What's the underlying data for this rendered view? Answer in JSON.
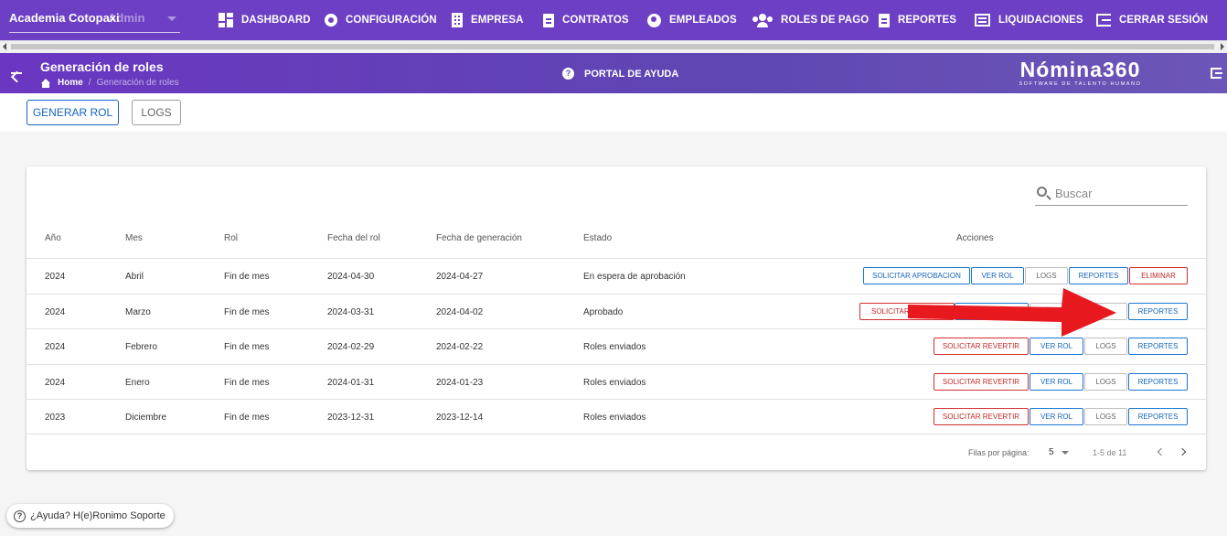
{
  "topnav": {
    "org_name": "Academia Cotopaxi",
    "org_role": "Admin",
    "items": [
      {
        "label": "DASHBOARD",
        "icon": "dashboard-icon"
      },
      {
        "label": "CONFIGURACIÓN",
        "icon": "gear-icon"
      },
      {
        "label": "EMPRESA",
        "icon": "building-icon"
      },
      {
        "label": "CONTRATOS",
        "icon": "clipboard-icon"
      },
      {
        "label": "EMPLEADOS",
        "icon": "globe-icon"
      },
      {
        "label": "ROLES DE PAGO",
        "icon": "users-icon"
      },
      {
        "label": "REPORTES",
        "icon": "clipboard-icon"
      },
      {
        "label": "LIQUIDACIONES",
        "icon": "list-icon"
      },
      {
        "label": "CERRAR SESIÓN",
        "icon": "logout-icon"
      }
    ]
  },
  "subheader": {
    "title": "Generación de roles",
    "breadcrumb_home": "Home",
    "breadcrumb_sep": "/",
    "breadcrumb_current": "Generación de roles",
    "help_portal": "PORTAL DE AYUDA",
    "brand_name": "Nómina360",
    "brand_tagline": "SOFTWARE DE TALENTO HUMANO"
  },
  "toolbar": {
    "generar_label": "GENERAR ROL",
    "logs_label": "LOGS"
  },
  "table": {
    "search_placeholder": "Buscar",
    "headers": {
      "anio": "Año",
      "mes": "Mes",
      "rol": "Rol",
      "fecha_rol": "Fecha del rol",
      "fecha_generacion": "Fecha de generación",
      "estado": "Estado",
      "acciones": "Acciones"
    },
    "rows": [
      {
        "anio": "2024",
        "mes": "Abril",
        "rol": "Fin de mes",
        "fecha_rol": "2024-04-30",
        "fecha_generacion": "2024-04-27",
        "estado": "En espera de aprobación",
        "actions": {
          "a1": "SOLICITAR APROBACION",
          "a2": "VER ROL",
          "a3": "LOGS",
          "a4": "REPORTES",
          "a5": "ELIMINAR"
        }
      },
      {
        "anio": "2024",
        "mes": "Marzo",
        "rol": "Fin de mes",
        "fecha_rol": "2024-03-31",
        "fecha_generacion": "2024-04-02",
        "estado": "Aprobado",
        "actions": {
          "a1": "SOLICITAR ",
          "a4": "REPORTES"
        }
      },
      {
        "anio": "2024",
        "mes": "Febrero",
        "rol": "Fin de mes",
        "fecha_rol": "2024-02-29",
        "fecha_generacion": "2024-02-22",
        "estado": "Roles enviados",
        "actions": {
          "a1": "SOLICITAR REVERTIR",
          "a2": "VER ROL",
          "a3": "LOGS",
          "a4": "REPORTES"
        }
      },
      {
        "anio": "2024",
        "mes": "Enero",
        "rol": "Fin de mes",
        "fecha_rol": "2024-01-31",
        "fecha_generacion": "2024-01-23",
        "estado": "Roles enviados",
        "actions": {
          "a1": "SOLICITAR REVERTIR",
          "a2": "VER ROL",
          "a3": "LOGS",
          "a4": "REPORTES"
        }
      },
      {
        "anio": "2023",
        "mes": "Diciembre",
        "rol": "Fin de mes",
        "fecha_rol": "2023-12-31",
        "fecha_generacion": "2023-12-14",
        "estado": "Roles enviados",
        "actions": {
          "a1": "SOLICITAR REVERTIR",
          "a2": "VER ROL",
          "a3": "LOGS",
          "a4": "REPORTES"
        }
      }
    ],
    "pagination": {
      "rows_per_page_label": "Filas por página:",
      "rows_per_page": "5",
      "range": "1-5 de 11"
    }
  },
  "help_chip": {
    "icon_glyph": "?",
    "label": "¿Ayuda? H(e)Ronimo Soporte"
  },
  "colors": {
    "nav_bg": "#6d3fc4",
    "primary_blue": "#1565c0",
    "danger_red": "#c62828",
    "annotation_red": "#e8191e"
  }
}
